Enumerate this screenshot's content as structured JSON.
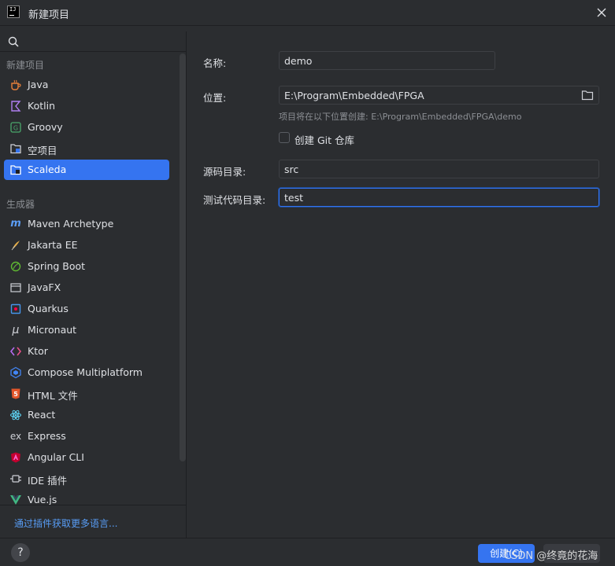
{
  "window": {
    "title": "新建项目",
    "logo_text": "IJ"
  },
  "search": {
    "placeholder": "",
    "value": ""
  },
  "sidebar": {
    "group_projects": "新建项目",
    "projects": [
      {
        "label": "Java",
        "icon": "java-icon"
      },
      {
        "label": "Kotlin",
        "icon": "kotlin-icon"
      },
      {
        "label": "Groovy",
        "icon": "groovy-icon"
      },
      {
        "label": "空项目",
        "icon": "empty-project-icon"
      },
      {
        "label": "Scaleda",
        "icon": "scaleda-icon",
        "selected": true
      }
    ],
    "group_generators": "生成器",
    "generators": [
      {
        "label": "Maven Archetype",
        "icon": "maven-icon"
      },
      {
        "label": "Jakarta EE",
        "icon": "jakarta-icon"
      },
      {
        "label": "Spring Boot",
        "icon": "spring-icon"
      },
      {
        "label": "JavaFX",
        "icon": "javafx-icon"
      },
      {
        "label": "Quarkus",
        "icon": "quarkus-icon"
      },
      {
        "label": "Micronaut",
        "icon": "micronaut-icon"
      },
      {
        "label": "Ktor",
        "icon": "ktor-icon"
      },
      {
        "label": "Compose Multiplatform",
        "icon": "compose-icon"
      },
      {
        "label": "HTML 文件",
        "icon": "html5-icon"
      },
      {
        "label": "React",
        "icon": "react-icon"
      },
      {
        "label": "Express",
        "icon": "express-icon"
      },
      {
        "label": "Angular CLI",
        "icon": "angular-icon"
      },
      {
        "label": "IDE 插件",
        "icon": "plugin-icon"
      },
      {
        "label": "Vue.js",
        "icon": "vue-icon"
      }
    ],
    "plugins_link": "通过插件获取更多语言..."
  },
  "form": {
    "name_label": "名称:",
    "name_value": "demo",
    "location_label": "位置:",
    "location_value": "E:\\Program\\Embedded\\FPGA",
    "location_hint": "项目将在以下位置创建: E:\\Program\\Embedded\\FPGA\\demo",
    "git_label": "创建 Git 仓库",
    "git_checked": false,
    "src_label": "源码目录:",
    "src_value": "src",
    "test_label": "测试代码目录:",
    "test_value": "test"
  },
  "footer": {
    "help": "?",
    "create": "创建(C)",
    "cancel": "",
    "watermark": "CSDN @终竟的花海"
  },
  "colors": {
    "accent": "#3574f0",
    "background": "#2b2d30",
    "link": "#589df6"
  }
}
